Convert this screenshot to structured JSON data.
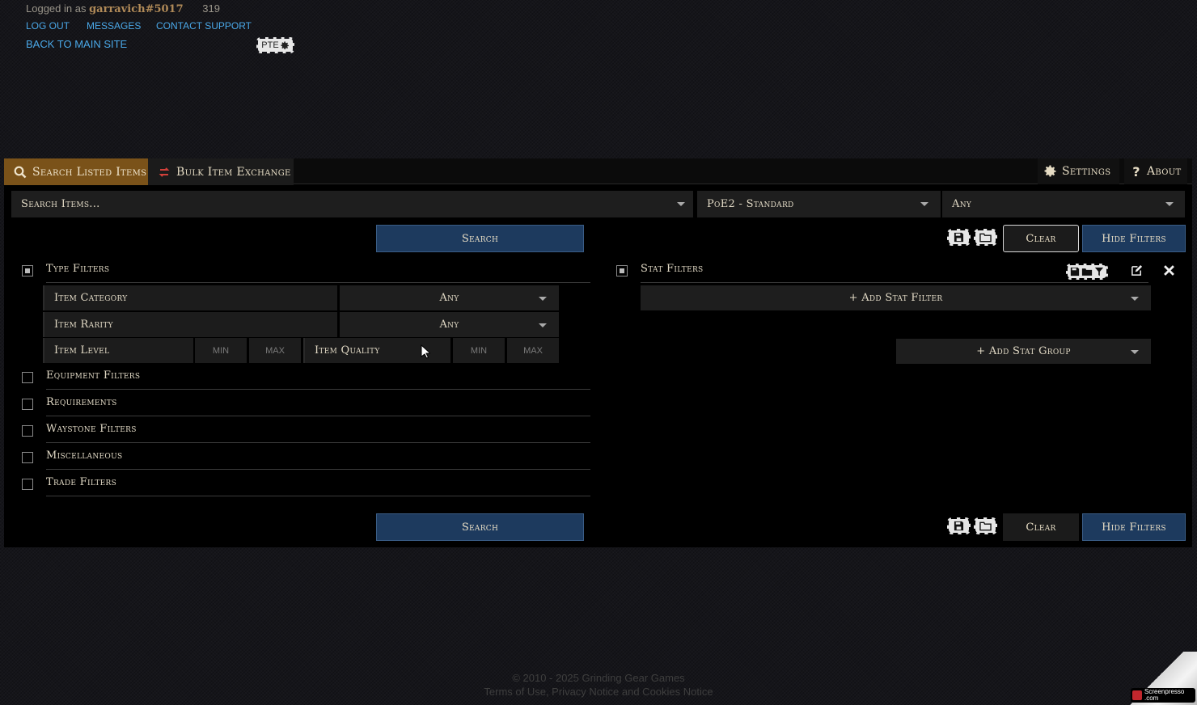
{
  "header": {
    "logged_in_prefix": "Logged in as",
    "username": "garravich#5017",
    "count": "319",
    "links": {
      "logout": "LOG OUT",
      "messages": "MESSAGES",
      "support": "CONTACT SUPPORT",
      "back": "BACK TO MAIN SITE"
    },
    "pte_label": "PTE"
  },
  "tabs": {
    "search": "Search Listed Items",
    "bulk": "Bulk Item Exchange",
    "settings": "Settings",
    "about": "About"
  },
  "search_bar": {
    "placeholder": "Search Items...",
    "league": "PoE2 - Standard",
    "status": "Any"
  },
  "buttons": {
    "search": "Search",
    "clear": "Clear",
    "hide_filters": "Hide Filters"
  },
  "type_filters": {
    "title": "Type Filters",
    "item_category": {
      "label": "Item Category",
      "value": "Any"
    },
    "item_rarity": {
      "label": "Item Rarity",
      "value": "Any"
    },
    "item_level": {
      "label": "Item Level",
      "min": "MIN",
      "max": "MAX"
    },
    "item_quality": {
      "label": "Item Quality",
      "min": "MIN",
      "max": "MAX"
    }
  },
  "filter_groups": [
    "Equipment Filters",
    "Requirements",
    "Waystone Filters",
    "Miscellaneous",
    "Trade Filters"
  ],
  "stat_filters": {
    "title": "Stat Filters",
    "add_filter": "+ Add Stat Filter",
    "add_group": "+ Add Stat Group"
  },
  "footer": {
    "copyright": "© 2010 - 2025 Grinding Gear Games",
    "terms": "Terms of Use, Privacy Notice and Cookies Notice"
  },
  "watermark": "Screenpresso .com",
  "colors": {
    "accent_tab": "#7a5219",
    "button_blue": "#1d3a5e",
    "link": "#4aa8e8",
    "username": "#b08a58"
  }
}
